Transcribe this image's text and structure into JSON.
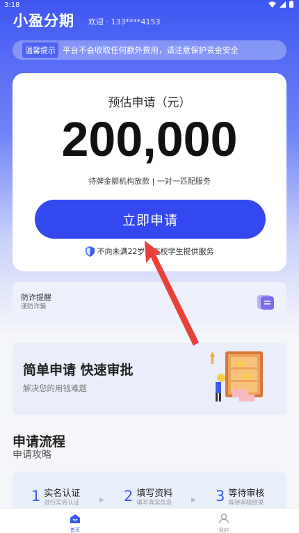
{
  "status_bar": {
    "time": "3:18"
  },
  "header": {
    "title": "小盈分期",
    "welcome": "欢迎 · 133****4153"
  },
  "notice": {
    "tag": "温馨提示",
    "text": "平台不会收取任何额外费用，请注意保护资金安全"
  },
  "main_card": {
    "label": "预估申请（元）",
    "amount": "200,000",
    "subtitle": "持牌金额机构放款 | 一对一匹配服务",
    "button": "立即申请",
    "age_note": "不向未满22岁及在校学生提供服务"
  },
  "fraud": {
    "title": "防诈提醒",
    "subtitle": "谨防诈骗"
  },
  "promo": {
    "title": "简单申请 快速审批",
    "subtitle": "解决您的用钱难题"
  },
  "process": {
    "title": "申请流程",
    "subtitle": "申请攻略",
    "steps": [
      {
        "num": "1",
        "title": "实名认证",
        "desc": "进行实名认证"
      },
      {
        "num": "2",
        "title": "填写资料",
        "desc": "填写真实信息"
      },
      {
        "num": "3",
        "title": "等待审核",
        "desc": "等待审核结果"
      }
    ]
  },
  "tabs": [
    {
      "label": "首页",
      "active": true
    },
    {
      "label": "我的",
      "active": false
    }
  ],
  "colors": {
    "primary": "#3448f0",
    "accent_red": "#e8403a"
  }
}
